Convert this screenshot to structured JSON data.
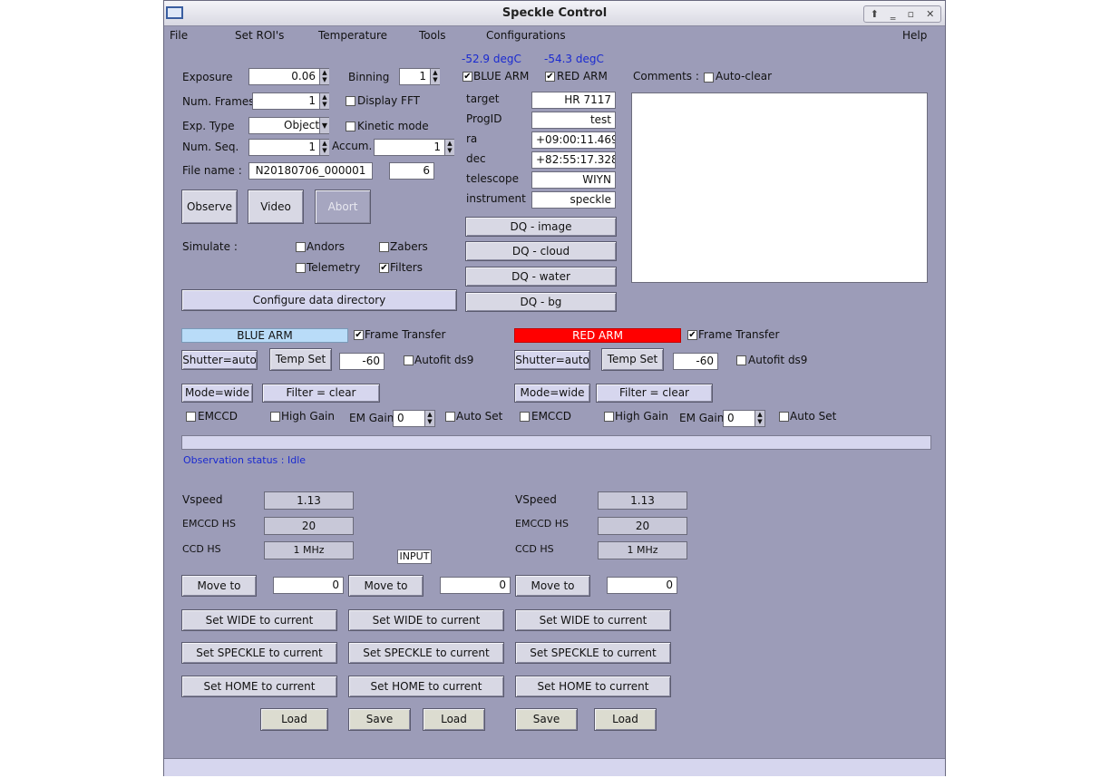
{
  "window": {
    "title": "Speckle Control"
  },
  "menu": {
    "file": "File",
    "set_rois": "Set ROI's",
    "temperature": "Temperature",
    "tools": "Tools",
    "configurations": "Configurations",
    "help": "Help"
  },
  "temps": {
    "blue": "-52.9 degC",
    "red": "-54.3 degC"
  },
  "exposure": {
    "label": "Exposure",
    "value": "0.06"
  },
  "binning": {
    "label": "Binning",
    "value": "1"
  },
  "num_frames": {
    "label": "Num. Frames",
    "value": "1"
  },
  "display_fft": {
    "label": "Display FFT",
    "checked": false
  },
  "exp_type": {
    "label": "Exp. Type",
    "value": "Object"
  },
  "kinetic_mode": {
    "label": "Kinetic mode",
    "checked": false
  },
  "num_seq": {
    "label": "Num. Seq.",
    "value": "1"
  },
  "accum": {
    "label": "Accum.",
    "value": "1"
  },
  "file_name": {
    "label": "File name :",
    "value": "N20180706_000001",
    "index": "6"
  },
  "arms": {
    "blue_label": "BLUE ARM",
    "red_label": "RED ARM",
    "blue_checked": true,
    "red_checked": true
  },
  "target_info": {
    "target_label": "target",
    "target": "HR 7117",
    "progid_label": "ProgID",
    "progid": "test",
    "ra_label": "ra",
    "ra": "+09:00:11.469",
    "dec_label": "dec",
    "dec": "+82:55:17.328",
    "telescope_label": "telescope",
    "telescope": "WIYN",
    "instrument_label": "instrument",
    "instrument": "speckle"
  },
  "comments": {
    "label": "Comments :",
    "autoclear": "Auto-clear"
  },
  "buttons": {
    "observe": "Observe",
    "video": "Video",
    "abort": "Abort",
    "configure": "Configure data directory"
  },
  "dq": {
    "image": "DQ - image",
    "cloud": "DQ - cloud",
    "water": "DQ - water",
    "bg": "DQ - bg"
  },
  "simulate": {
    "label": "Simulate :",
    "andors": "Andors",
    "zabers": "Zabers",
    "telemetry": "Telemetry",
    "filters": "Filters",
    "filters_checked": true
  },
  "blue": {
    "header": "BLUE ARM",
    "frame_transfer": "Frame Transfer",
    "shutter": "Shutter=auto",
    "temp_set": "Temp Set",
    "temp_value": "-60",
    "autofit": "Autofit ds9",
    "mode": "Mode=wide",
    "filter": "Filter = clear",
    "emccd": "EMCCD",
    "high_gain": "High Gain",
    "em_gain_label": "EM Gain",
    "em_gain": "0",
    "auto_set": "Auto Set",
    "vspeed_label": "Vspeed",
    "vspeed": "1.13",
    "emccd_hs_label": "EMCCD HS",
    "emccd_hs": "20",
    "ccd_hs_label": "CCD HS",
    "ccd_hs": "1 MHz"
  },
  "red": {
    "header": "RED ARM",
    "frame_transfer": "Frame Transfer",
    "shutter": "Shutter=auto",
    "temp_set": "Temp Set",
    "temp_value": "-60",
    "autofit": "Autofit ds9",
    "mode": "Mode=wide",
    "filter": "Filter = clear",
    "emccd": "EMCCD",
    "high_gain": "High Gain",
    "em_gain_label": "EM Gain",
    "em_gain": "0",
    "auto_set": "Auto Set",
    "vspeed_label": "VSpeed",
    "vspeed": "1.13",
    "emccd_hs_label": "EMCCD HS",
    "emccd_hs": "20",
    "ccd_hs_label": "CCD HS",
    "ccd_hs": "1 MHz"
  },
  "status": {
    "text": "Observation status : Idle"
  },
  "input_label": "INPUT",
  "stages": {
    "move_to": "Move to",
    "set_wide": "Set WIDE to current",
    "set_speckle": "Set SPECKLE to current",
    "set_home": "Set HOME to current",
    "values": [
      "0",
      "0",
      "0"
    ]
  },
  "bottom": {
    "load": "Load",
    "save": "Save"
  },
  "colors": {
    "window_bg": "#9c9cb8",
    "status_blue": "#1a2ad0",
    "blue_arm": "#b9dcf8",
    "red_arm": "#ff0000"
  }
}
